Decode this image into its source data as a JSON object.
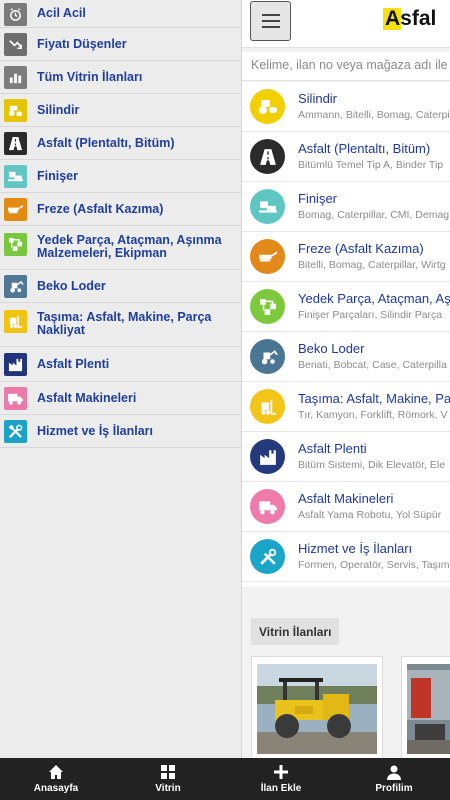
{
  "drawer": {
    "items": [
      {
        "label": "Acil Acil",
        "icon": "alarm-clock-icon",
        "color": "#7a7a7a"
      },
      {
        "label": "Fiyatı Düşenler",
        "icon": "trend-down-icon",
        "color": "#6e6e6e"
      },
      {
        "label": "Tüm Vitrin İlanları",
        "icon": "bar-chart-icon",
        "color": "#7d7d7d"
      },
      {
        "label": "Silindir",
        "icon": "road-roller-icon",
        "color": "#e7c400"
      },
      {
        "label": "Asfalt (Plentaltı, Bitüm)",
        "icon": "road-icon",
        "color": "#2a2a2a"
      },
      {
        "label": "Finişer",
        "icon": "paver-icon",
        "color": "#62c6c3"
      },
      {
        "label": "Freze (Asfalt Kazıma)",
        "icon": "milling-machine-icon",
        "color": "#e38a10"
      },
      {
        "label": "Yedek Parça, Ataçman, Aşınma Malzemeleri, Ekipman",
        "icon": "parts-icon",
        "color": "#79c73d"
      },
      {
        "label": "Beko Loder",
        "icon": "backhoe-loader-icon",
        "color": "#4f7897"
      },
      {
        "label": "Taşıma: Asfalt, Makine, Parça Nakliyat",
        "icon": "forklift-icon",
        "color": "#f1c40f"
      },
      {
        "label": "Asfalt Plenti",
        "icon": "factory-icon",
        "color": "#23357a"
      },
      {
        "label": "Asfalt Makineleri",
        "icon": "truck-icon",
        "color": "#ec7aa8"
      },
      {
        "label": "Hizmet ve İş İlanları",
        "icon": "tools-icon",
        "color": "#1aa3c7"
      }
    ]
  },
  "header": {
    "logo_text": "Asfal",
    "menu_icon": "hamburger-menu-icon"
  },
  "search": {
    "placeholder": "Kelime, ilan no veya mağaza adı ile"
  },
  "categories": [
    {
      "title": "Silindir",
      "sub": "Ammann, Bitelli, Bomag, Caterpi",
      "icon": "road-roller-icon",
      "color": "#f2cf00"
    },
    {
      "title": "Asfalt (Plentaltı, Bitüm)",
      "sub": "Bitümlü Temel Tip A, Binder Tip",
      "icon": "road-icon",
      "color": "#2b2b2b"
    },
    {
      "title": "Finişer",
      "sub": "Bomag, Caterpillar, CMI, Demag",
      "icon": "paver-icon",
      "color": "#5ec7c2"
    },
    {
      "title": "Freze (Asfalt Kazıma)",
      "sub": "Bitelli, Bomag, Caterpillar, Wirtg",
      "icon": "milling-machine-icon",
      "color": "#e3891a"
    },
    {
      "title": "Yedek Parça, Ataçman, Aş",
      "sub": "Finişer Parçaları, Silindir Parça",
      "icon": "parts-icon",
      "color": "#7cc93c"
    },
    {
      "title": "Beko Loder",
      "sub": "Benati, Bobcat, Case, Caterpilla",
      "icon": "backhoe-loader-icon",
      "color": "#4a7593"
    },
    {
      "title": "Taşıma: Asfalt, Makine, Pa",
      "sub": "Tır, Kamyon, Forklift, Römork, V",
      "icon": "forklift-icon",
      "color": "#f3c51a"
    },
    {
      "title": "Asfalt Plenti",
      "sub": "Bitüm Sistemi, Dik Elevatör, Ele",
      "icon": "factory-icon",
      "color": "#243a7c"
    },
    {
      "title": "Asfalt Makineleri",
      "sub": "Asfalt Yama Robotu, Yol Süpür",
      "icon": "truck-icon",
      "color": "#ef7bab"
    },
    {
      "title": "Hizmet ve İş İlanları",
      "sub": "Formen, Operatör, Servis, Taşım",
      "icon": "tools-icon",
      "color": "#1ba6c9"
    }
  ],
  "vitrin": {
    "tab_label": "Vitrin İlanları"
  },
  "bottom_nav": [
    {
      "label": "Anasayfa",
      "icon": "home-icon"
    },
    {
      "label": "Vitrin",
      "icon": "grid-icon"
    },
    {
      "label": "İlan Ekle",
      "icon": "plus-icon"
    },
    {
      "label": "Profilim",
      "icon": "user-icon"
    }
  ]
}
